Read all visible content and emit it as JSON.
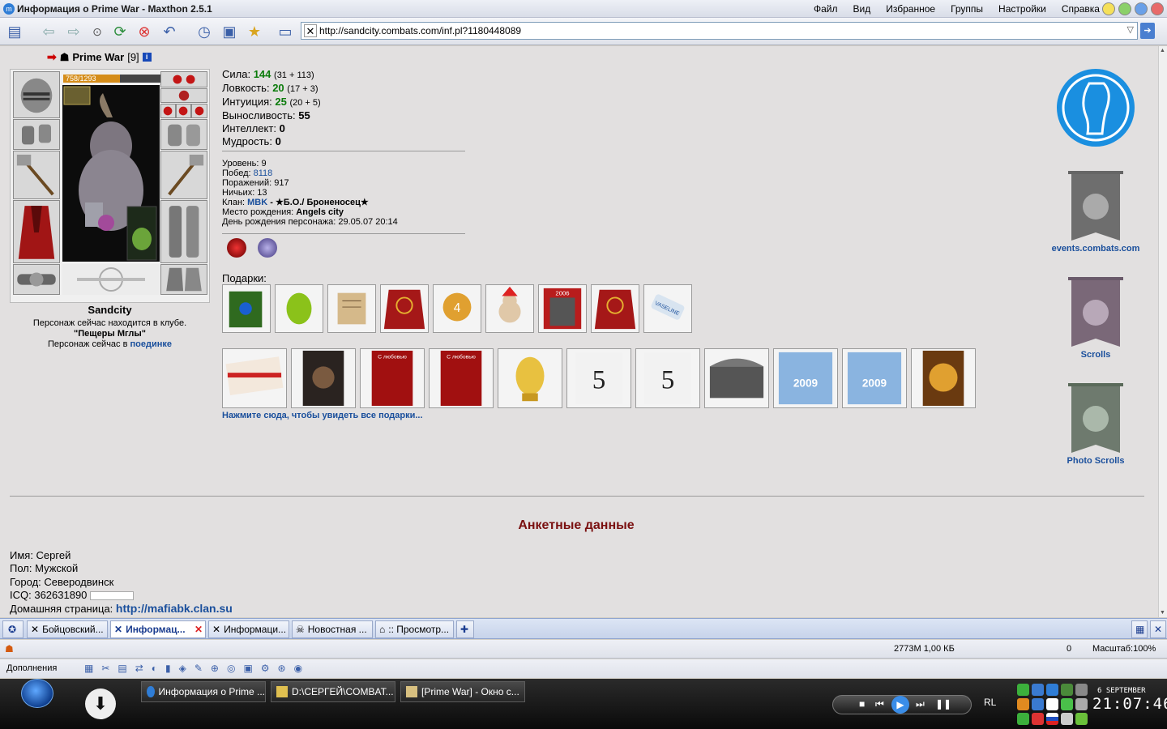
{
  "window": {
    "title": "Информация о Prime War - Maxthon 2.5.1",
    "menu": [
      "Файл",
      "Вид",
      "Избранное",
      "Группы",
      "Настройки",
      "Справка"
    ]
  },
  "address": {
    "url": "http://sandcity.combats.com/inf.pl?1180448089"
  },
  "character": {
    "name": "Prime War",
    "level": "[9]",
    "hp": "758/1293",
    "hp_fraction": 0.586,
    "city": "Sandcity",
    "location_line1": "Персонаж сейчас находится в клубе.",
    "location_club": "\"Пещеры Мглы\"",
    "location_line3_prefix": "Персонаж сейчас в",
    "location_line3_link": "поединке"
  },
  "stats": [
    {
      "label": "Сила:",
      "value": "144",
      "detail": "(31 + 113)",
      "green": true
    },
    {
      "label": "Ловкость:",
      "value": "20",
      "detail": "(17 + 3)",
      "green": true
    },
    {
      "label": "Интуиция:",
      "value": "25",
      "detail": "(20 + 5)",
      "green": true
    },
    {
      "label": "Выносливость:",
      "value": "55",
      "detail": "",
      "green": false
    },
    {
      "label": "Интеллект:",
      "value": "0",
      "detail": "",
      "green": false
    },
    {
      "label": "Мудрость:",
      "value": "0",
      "detail": "",
      "green": false
    }
  ],
  "info": {
    "level": "Уровень: 9",
    "wins_label": "Побед:",
    "wins": "8118",
    "losses": "Поражений: 917",
    "draws": "Ничьих: 13",
    "clan_label": "Клан:",
    "clan_link": "MBK",
    "clan_name": " - ★Б.О./ Броненосец★",
    "birthplace_label": "Место рождения:",
    "birthplace": "Angels city",
    "birthday": "День рождения персонажа: 29.05.07 20:14"
  },
  "gifts": {
    "label": "Подарки:",
    "all_link": "Нажмите сюда, чтобы увидеть все подарки...",
    "row1_year_label": "2006",
    "row1_bottle_label": "VASELINE",
    "row2_card_label": "С любовью",
    "row2_year_label": "2009",
    "row2_num_label": "5"
  },
  "right_links": [
    {
      "label": "events.combats.com",
      "emblem": "events"
    },
    {
      "label": "Scrolls",
      "emblem": "scrolls"
    },
    {
      "label": "Photo Scrolls",
      "emblem": "photo"
    }
  ],
  "profile": {
    "heading": "Анкетные данные",
    "name": "Имя: Сергей",
    "sex": "Пол: Мужской",
    "city": "Город: Северодвинск",
    "icq": "ICQ: 362631890",
    "homepage_label": "Домашняя страница:",
    "homepage": "http://mafiabk.clan.su"
  },
  "tabs": [
    {
      "label": "Бойцовский...",
      "active": false
    },
    {
      "label": "Информац...",
      "active": true
    },
    {
      "label": "Информаци...",
      "active": false
    },
    {
      "label": "Новостная ...",
      "active": false
    },
    {
      "label": ":: Просмотр...",
      "active": false
    }
  ],
  "status": {
    "memory": "2773M 1,00 КБ",
    "counter": "0",
    "zoom": "Масштаб:100%"
  },
  "plugins_label": "Дополнения",
  "taskbar": {
    "tasks": [
      "Информация о Prime ...",
      "D:\\СЕРГЕЙ\\COMBAT...",
      "[Prime War] - Окно с..."
    ],
    "lang": "RL",
    "date": "6 SEPTEMBER",
    "time": "21:07:46"
  },
  "colors": {
    "accent": "#1a4f9c",
    "heading": "#7a1010",
    "stat_green": "#0a7b0a"
  }
}
